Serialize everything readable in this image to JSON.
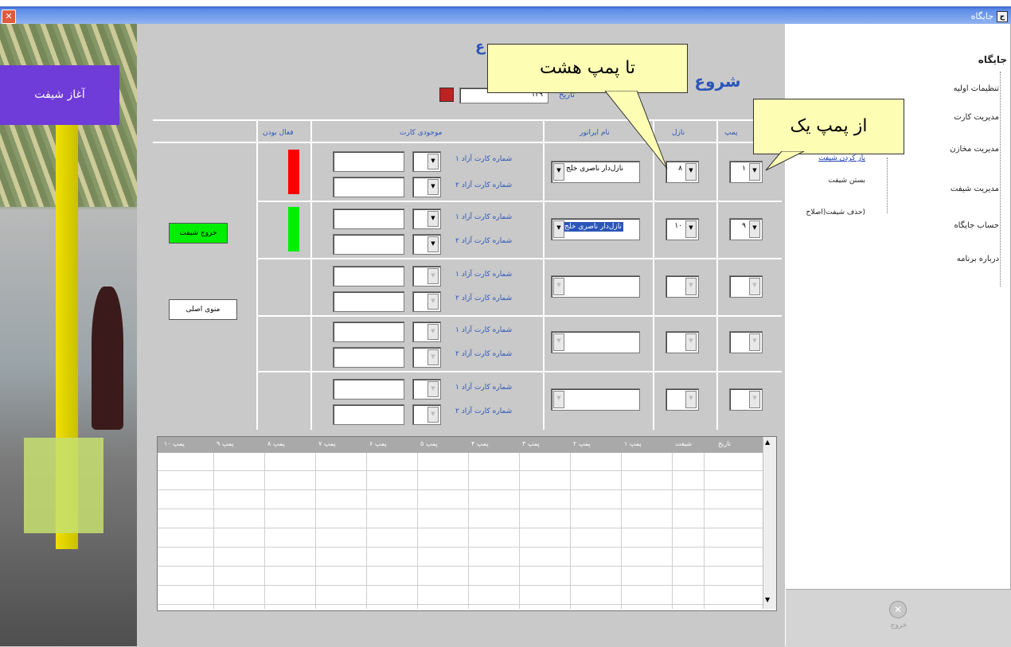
{
  "window": {
    "title": "جایگاه",
    "icon_letter": "ج"
  },
  "nav": {
    "title": "جایگاه",
    "items": [
      "تنظیمات اولیه",
      "مدیریت کارت",
      "مدیریت مخازن",
      "مدیریت شیفت",
      "حساب جایگاه",
      "درباره برنامه"
    ],
    "shift_submenu": [
      "باز کردن شیفت",
      "بستن شیفت",
      "(حذف شیفت(اصلاح"
    ],
    "close_label": "خروج"
  },
  "form": {
    "title": "شروع شیفت",
    "title_top": "ع",
    "date_label": "تاریخ",
    "date_value": "۱۳۹",
    "columns": {
      "pump": "پمپ",
      "nozzle": "نازل",
      "operator": "نام اپراتور",
      "card_balance": "موجودی کارت",
      "active": "فعال بودن"
    },
    "card_line1": "شماره کارت آزاد ۱",
    "card_line2": "شماره کارت آزاد ۲",
    "rows": [
      {
        "pump": "۱",
        "nozzle": "۸",
        "operator": "نازل‌دار ناصری خلج",
        "highlight": false,
        "status_color": "#ff0000"
      },
      {
        "pump": "۹",
        "nozzle": "۱۰",
        "operator": "نازل‌دار ناصری خلج",
        "highlight": true,
        "status_color": "#00ee00"
      },
      {
        "pump": "",
        "nozzle": "",
        "operator": "",
        "highlight": false,
        "status_color": ""
      },
      {
        "pump": "",
        "nozzle": "",
        "operator": "",
        "highlight": false,
        "status_color": ""
      },
      {
        "pump": "",
        "nozzle": "",
        "operator": "",
        "highlight": false,
        "status_color": ""
      }
    ],
    "exit_shift_button": "خروج شیفت",
    "main_menu_button": "منوی اصلی"
  },
  "grid": {
    "headers": [
      "تاریخ",
      "شیفت",
      "پمپ ۱",
      "پمپ ۲",
      "پمپ ۳",
      "پمپ ۴",
      "پمپ ۵",
      "پمپ ۶",
      "پمپ ۷",
      "پمپ ۸",
      "پمپ ۹",
      "پمپ ۱۰"
    ]
  },
  "photo": {
    "button_label": "آغاز شیفت"
  },
  "callouts": {
    "to_pump_eight": "تا پمپ هشت",
    "from_pump_one": "از پمپ یک"
  },
  "colors": {
    "accent": "#2a55b8",
    "exit_button": "#00ee00",
    "status_red": "#ff0000",
    "status_green": "#00ee00",
    "callout_fill": "#fdfdb4"
  }
}
